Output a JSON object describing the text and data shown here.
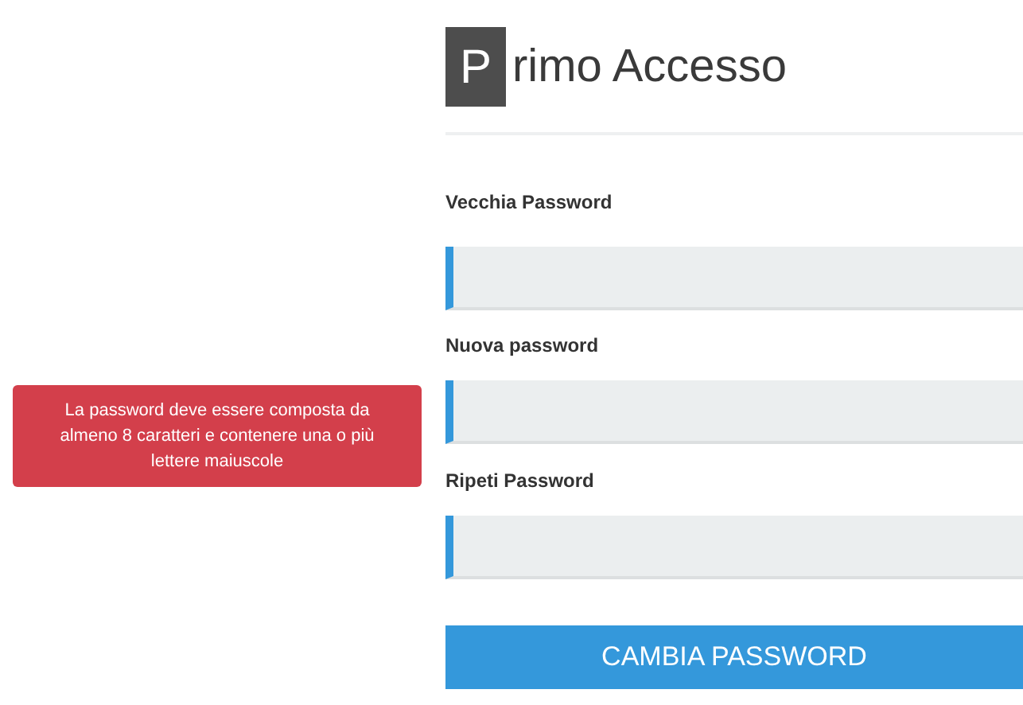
{
  "title": {
    "initial": "P",
    "rest": "rimo Accesso"
  },
  "alert": {
    "text": "La password deve essere composta da almeno 8 caratteri e contenere una o più lettere maiuscole"
  },
  "fields": [
    {
      "label": "Vecchia Password"
    },
    {
      "label": "Nuova password"
    },
    {
      "label": "Ripeti Password"
    }
  ],
  "submit": {
    "label": "CAMBIA PASSWORD"
  }
}
